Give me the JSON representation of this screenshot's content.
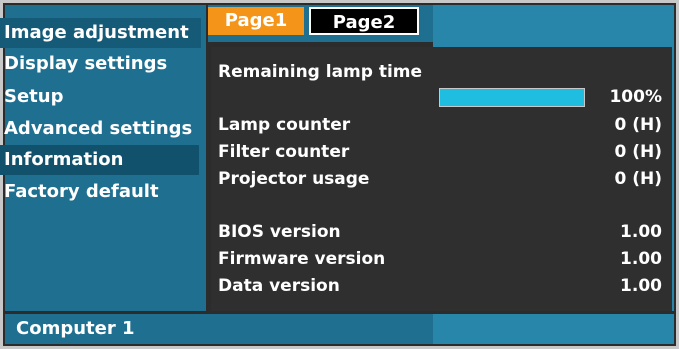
{
  "menu": {
    "items": [
      {
        "label": "Image adjustment"
      },
      {
        "label": "Display settings"
      },
      {
        "label": "Setup"
      },
      {
        "label": "Advanced settings"
      },
      {
        "label": "Information"
      },
      {
        "label": "Factory default"
      }
    ],
    "selected": "Information"
  },
  "tabs": [
    {
      "label": "Page1",
      "active": true
    },
    {
      "label": "Page2",
      "active": false
    }
  ],
  "info": {
    "remaining_lamp_label": "Remaining lamp time",
    "remaining_lamp_value": "100%",
    "remaining_lamp_fraction": 1.0,
    "rows": [
      {
        "label": "Lamp counter",
        "value": "0 (H)"
      },
      {
        "label": "Filter counter",
        "value": "0 (H)"
      },
      {
        "label": "Projector usage",
        "value": "0 (H)"
      },
      {
        "label": "BIOS version",
        "value": "1.00"
      },
      {
        "label": "Firmware version",
        "value": "1.00"
      },
      {
        "label": "Data version",
        "value": "1.00"
      }
    ]
  },
  "footer": {
    "source": "Computer 1"
  },
  "colors": {
    "menu_bg": "#1f6f91",
    "menu_selected": "#11516b",
    "tab_active": "#f4951a",
    "bar_fill": "#1fbde0",
    "panel_bg": "#2f2f2f"
  }
}
